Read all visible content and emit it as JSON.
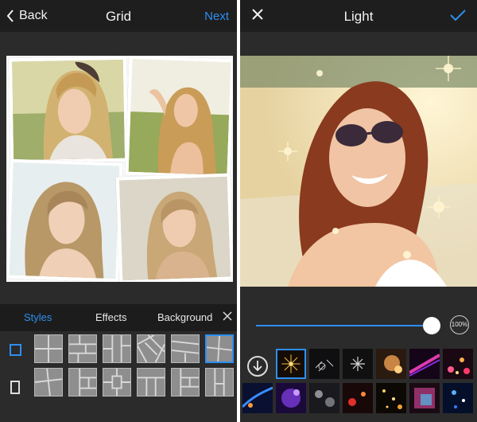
{
  "left": {
    "header": {
      "back_label": "Back",
      "title": "Grid",
      "next_label": "Next"
    },
    "tabs": [
      {
        "label": "Styles",
        "active": true
      },
      {
        "label": "Effects",
        "active": false
      },
      {
        "label": "Background",
        "active": false
      }
    ],
    "ratios": [
      "square",
      "portrait"
    ],
    "layouts_row1": [
      "grid-2x2",
      "grid-offset",
      "grid-3col",
      "grid-pinwheel",
      "grid-stripes",
      "grid-tilted"
    ],
    "layouts_row2": [
      "grid-angled",
      "grid-mixed",
      "grid-cross",
      "grid-bars",
      "grid-blocks",
      "grid-tall"
    ],
    "selected_layout": "grid-tilted"
  },
  "right": {
    "header": {
      "title": "Light"
    },
    "intensity": {
      "value": 1.0,
      "label": "100%"
    },
    "effects_row1": [
      "sparkle-gold",
      "snowflakes",
      "starburst",
      "bokeh-warm",
      "light-streak",
      "bokeh-pink"
    ],
    "effects_row2": [
      "lens-flare",
      "purple-glow",
      "bokeh-silver",
      "bokeh-red",
      "gold-dust",
      "neon-blur",
      "blue-sparkle"
    ],
    "selected_effect": "sparkle-gold"
  },
  "colors": {
    "accent": "#2d8ff0",
    "bar": "#1e1e1e",
    "panel": "#2b2b2b"
  }
}
